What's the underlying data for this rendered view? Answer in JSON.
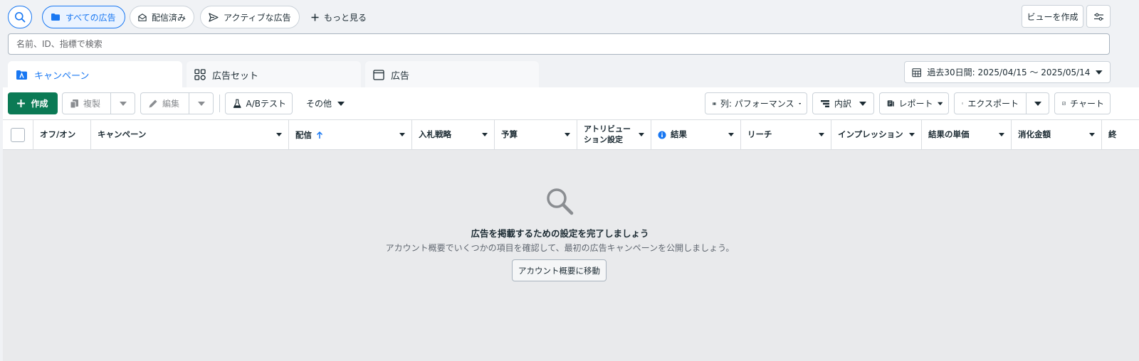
{
  "filters": {
    "all_ads": "すべての広告",
    "delivered": "配信済み",
    "active_ads": "アクティブな広告",
    "see_more": "もっと見る"
  },
  "header": {
    "create_view": "ビューを作成"
  },
  "search": {
    "placeholder": "名前、ID、指標で検索"
  },
  "tabs": [
    {
      "label": "キャンペーン",
      "active": true
    },
    {
      "label": "広告セット",
      "active": false
    },
    {
      "label": "広告",
      "active": false
    }
  ],
  "date_range": {
    "label": "過去30日間: 2025/04/15 ～ 2025/05/14"
  },
  "toolbar": {
    "create": "作成",
    "duplicate": "複製",
    "edit": "編集",
    "ab_test": "A/Bテスト",
    "other": "その他",
    "columns": "列: パフォーマンス",
    "breakdown": "内訳",
    "reports": "レポート",
    "export": "エクスポート",
    "chart": "チャート"
  },
  "table": {
    "columns": [
      {
        "label": "オフ/オン"
      },
      {
        "label": "キャンペーン"
      },
      {
        "label": "配信"
      },
      {
        "label": "入札戦略"
      },
      {
        "label": "予算"
      },
      {
        "label": "アトリビューション設定"
      },
      {
        "label": "結果"
      },
      {
        "label": "リーチ"
      },
      {
        "label": "インプレッション"
      },
      {
        "label": "結果の単価"
      },
      {
        "label": "消化金額"
      },
      {
        "label": "終"
      }
    ]
  },
  "empty_state": {
    "title": "広告を掲載するための設定を完了しましょう",
    "subtitle": "アカウント概要でいくつかの項目を確認して、最初の広告キャンペーンを公開しましょう。",
    "button": "アカウント概要に移動"
  },
  "colors": {
    "accent": "#1877f2",
    "create_green": "#0b7a55"
  }
}
